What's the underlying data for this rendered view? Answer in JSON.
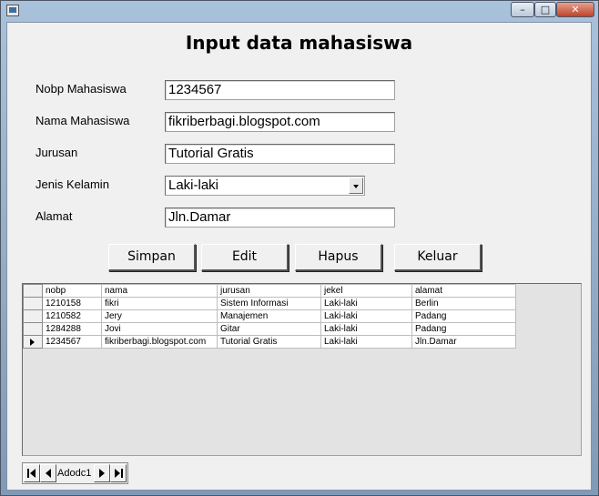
{
  "window": {
    "controls": {
      "minimize": "–",
      "maximize": "□",
      "close": "✕"
    }
  },
  "form": {
    "title": "Input data mahasiswa",
    "fields": [
      {
        "label": "Nobp Mahasiswa",
        "value": "1234567"
      },
      {
        "label": "Nama Mahasiswa",
        "value": "fikriberbagi.blogspot.com"
      },
      {
        "label": "Jurusan",
        "value": "Tutorial Gratis"
      },
      {
        "label": "Jenis Kelamin",
        "value": "Laki-laki"
      },
      {
        "label": "Alamat",
        "value": "Jln.Damar"
      }
    ],
    "buttons": [
      "Simpan",
      "Edit",
      "Hapus",
      "Keluar"
    ]
  },
  "grid": {
    "columns": [
      "nobp",
      "nama",
      "jurusan",
      "jekel",
      "alamat"
    ],
    "rows": [
      [
        "1210158",
        "fikri",
        "Sistem Informasi",
        "Laki-laki",
        "Berlin"
      ],
      [
        "1210582",
        "Jery",
        "Manajemen",
        "Laki-laki",
        "Padang"
      ],
      [
        "1284288",
        "Jovi",
        "Gitar",
        "Laki-laki",
        "Padang"
      ],
      [
        "1234567",
        "fikriberbagi.blogspot.com",
        "Tutorial Gratis",
        "Laki-laki",
        "Jln.Damar"
      ]
    ],
    "current_row": 4
  },
  "navigator": {
    "caption": "Adodc1",
    "icons": [
      "first-record-icon",
      "previous-record-icon",
      "next-record-icon",
      "last-record-icon"
    ]
  }
}
